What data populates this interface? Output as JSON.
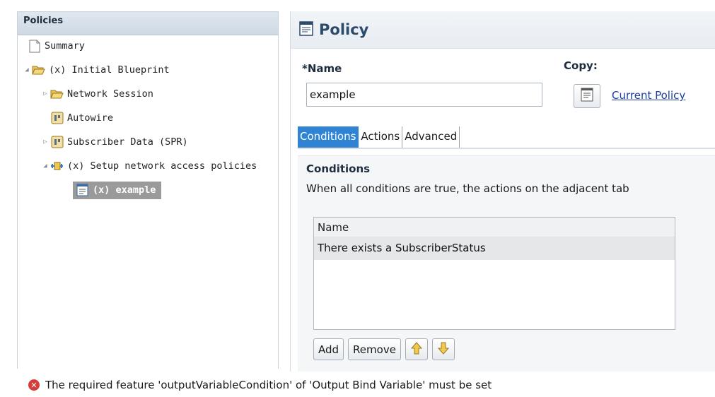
{
  "tree": {
    "header": "Policies",
    "items": [
      {
        "label": "Summary",
        "icon": "page-icon"
      },
      {
        "label": "(x) Initial Blueprint",
        "icon": "folder-open-icon"
      },
      {
        "label": "Network Session",
        "icon": "folder-open-icon"
      },
      {
        "label": "Autowire",
        "icon": "component-icon"
      },
      {
        "label": "Subscriber Data (SPR)",
        "icon": "component-icon"
      },
      {
        "label": "(x) Setup network access policies",
        "icon": "policy-group-icon"
      },
      {
        "label": "(x) example",
        "icon": "policy-doc-icon",
        "selected": true
      }
    ]
  },
  "policy": {
    "title": "Policy",
    "name_label": "Name",
    "name_required_mark": "*",
    "name_value": "example",
    "copy_label": "Copy:",
    "copy_link": "Current Policy",
    "tabs": [
      "Conditions",
      "Actions",
      "Advanced"
    ],
    "active_tab": "Conditions",
    "conditions": {
      "title": "Conditions",
      "description": "When all conditions are true, the actions on the adjacent tab",
      "table_header": "Name",
      "rows": [
        "There exists a SubscriberStatus"
      ],
      "buttons": {
        "add": "Add",
        "remove": "Remove",
        "up": "up-arrow-icon",
        "down": "down-arrow-icon"
      }
    }
  },
  "status": {
    "icon": "error-icon",
    "message": "The required feature 'outputVariableCondition' of 'Output Bind Variable' must be set"
  },
  "colors": {
    "active_tab": "#2f83d2",
    "selection": "#9a9a9a",
    "link": "#1a3d9e",
    "error": "#d63c3c"
  }
}
